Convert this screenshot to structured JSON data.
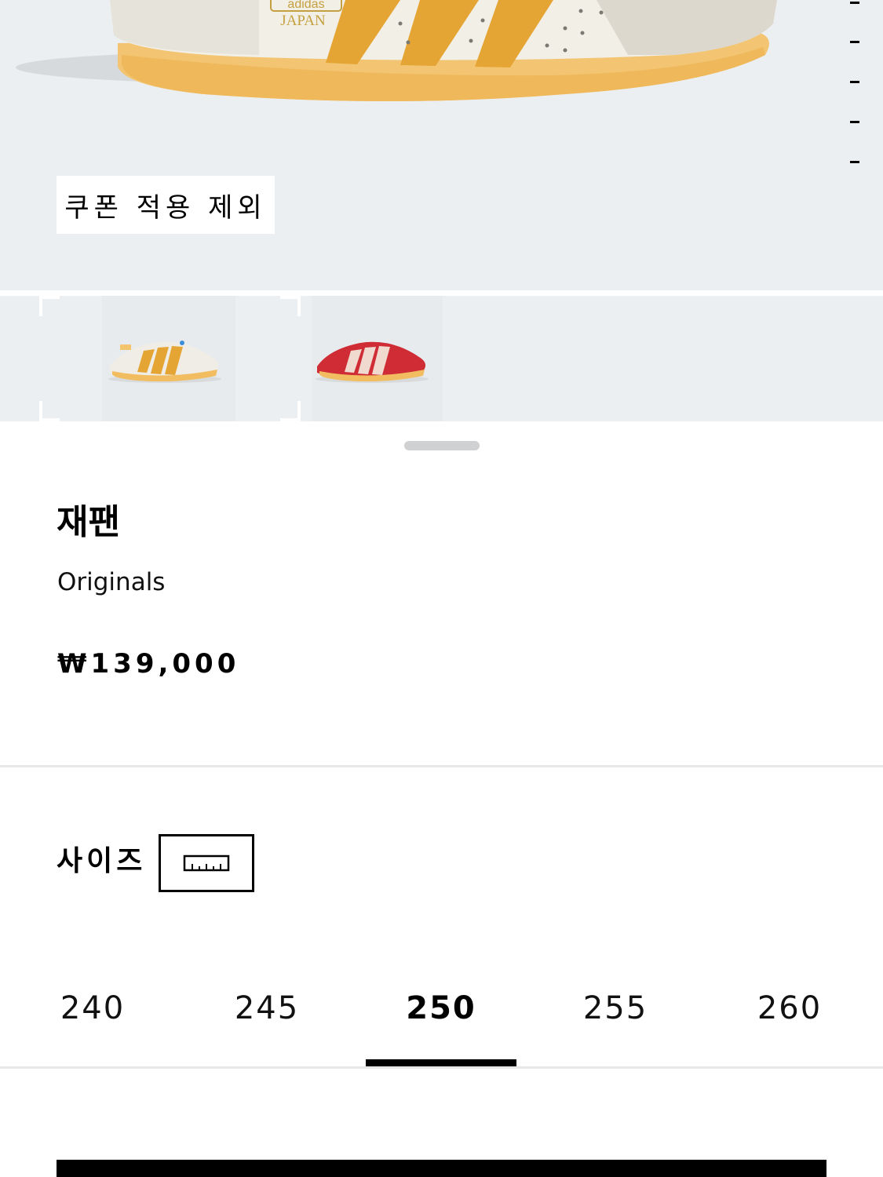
{
  "hero": {
    "shoe_logo_text": "adidas",
    "shoe_logo_subtext": "JAPAN",
    "coupon_badge": "쿠폰 적용 제외",
    "image_count": 5,
    "colors": {
      "background": "#eceff1",
      "stripe": "#e5a534",
      "upper": "#f1efe8",
      "sole": "#f4c46e"
    }
  },
  "thumbnails": [
    {
      "colorway": "white-orange",
      "selected": true
    },
    {
      "colorway": "red-cream",
      "selected": false
    }
  ],
  "product": {
    "title": "재팬",
    "brand": "Originals",
    "price": "₩139,000"
  },
  "size_section": {
    "label": "사이즈",
    "guide_icon": "ruler-icon",
    "sizes": [
      "240",
      "245",
      "250",
      "255",
      "260"
    ],
    "selected": "250"
  }
}
